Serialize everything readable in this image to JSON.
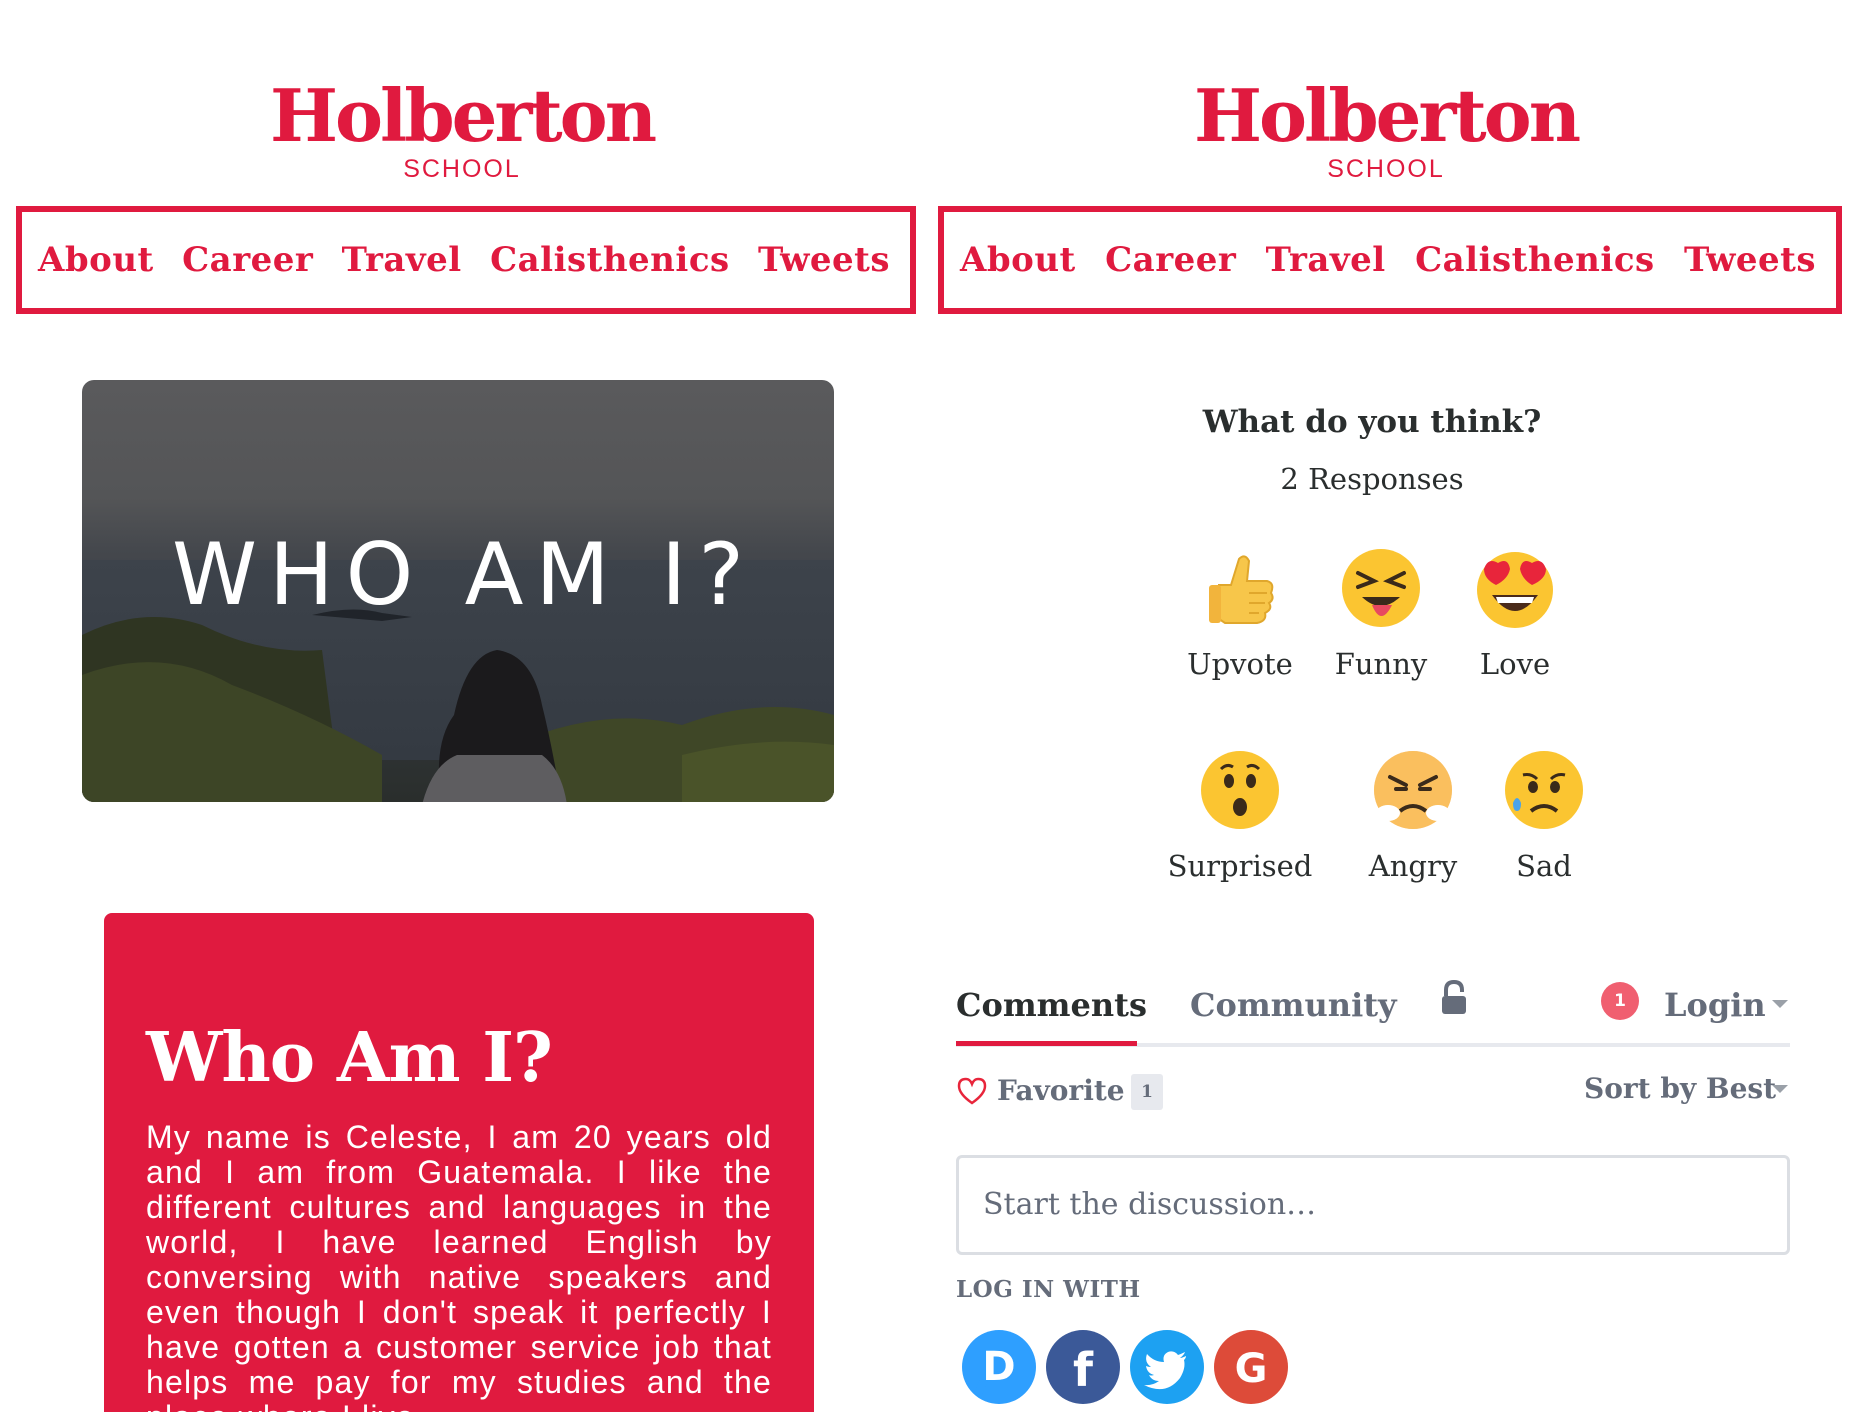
{
  "brand": {
    "name": "Holberton",
    "sub": "SCHOOL",
    "color": "#e01a3f"
  },
  "nav": {
    "items": [
      {
        "label": "About"
      },
      {
        "label": "Career"
      },
      {
        "label": "Travel"
      },
      {
        "label": "Calisthenics"
      },
      {
        "label": "Tweets"
      }
    ]
  },
  "hero": {
    "title": "WHO AM I?"
  },
  "card": {
    "title": "Who Am I?",
    "text": "My name is Celeste, I am 20 years old and I am from Guatemala. I like the different cultures and languages in the world, I have learned English by conversing with native speakers and even though I don't speak it perfectly I have gotten a customer service job that helps me pay for my studies and the place where I live."
  },
  "reactions": {
    "question": "What do you think?",
    "responses": "2 Responses",
    "items": [
      {
        "label": "Upvote",
        "icon": "thumbs-up-icon"
      },
      {
        "label": "Funny",
        "icon": "laughing-face-icon"
      },
      {
        "label": "Love",
        "icon": "heart-eyes-face-icon"
      },
      {
        "label": "Surprised",
        "icon": "surprised-face-icon"
      },
      {
        "label": "Angry",
        "icon": "angry-face-icon"
      },
      {
        "label": "Sad",
        "icon": "sad-face-icon"
      }
    ]
  },
  "discussion": {
    "tabs": {
      "comments": "Comments",
      "community": "Community"
    },
    "notification_count": "1",
    "login_label": "Login",
    "favorite_label": "Favorite",
    "favorite_count": "1",
    "sort_label": "Sort by Best",
    "input_placeholder": "Start the discussion…",
    "login_with": "LOG IN WITH",
    "social": [
      {
        "name": "disqus",
        "letter": "D",
        "color": "#2e9fff"
      },
      {
        "name": "facebook",
        "letter": "f",
        "color": "#3b5998"
      },
      {
        "name": "twitter",
        "letter": "",
        "color": "#1da1f2"
      },
      {
        "name": "google",
        "letter": "G",
        "color": "#dd4b39"
      }
    ]
  }
}
